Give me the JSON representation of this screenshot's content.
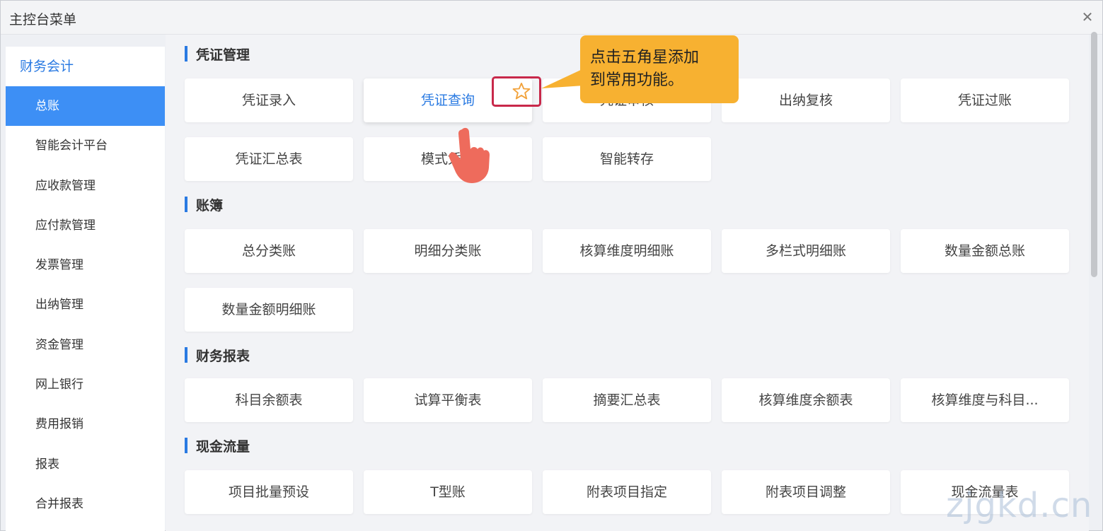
{
  "window": {
    "title": "主控台菜单"
  },
  "sidebar": {
    "module": "财务会计",
    "items": [
      {
        "label": "总账",
        "active": true
      },
      {
        "label": "智能会计平台"
      },
      {
        "label": "应收款管理"
      },
      {
        "label": "应付款管理"
      },
      {
        "label": "发票管理"
      },
      {
        "label": "出纳管理"
      },
      {
        "label": "资金管理"
      },
      {
        "label": "网上银行"
      },
      {
        "label": "费用报销"
      },
      {
        "label": "报表"
      },
      {
        "label": "合并报表"
      }
    ]
  },
  "sections": [
    {
      "title": "凭证管理",
      "tiles": [
        "凭证录入",
        "凭证查询",
        "凭证审核",
        "出纳复核",
        "凭证过账",
        "凭证汇总表",
        "模式凭证",
        "智能转存"
      ]
    },
    {
      "title": "账簿",
      "tiles": [
        "总分类账",
        "明细分类账",
        "核算维度明细账",
        "多栏式明细账",
        "数量金额总账",
        "数量金额明细账"
      ]
    },
    {
      "title": "财务报表",
      "tiles": [
        "科目余额表",
        "试算平衡表",
        "摘要汇总表",
        "核算维度余额表",
        "核算维度与科目..."
      ]
    },
    {
      "title": "现金流量",
      "tiles": [
        "项目批量预设",
        "T型账",
        "附表项目指定",
        "附表项目调整",
        "现金流量表"
      ]
    }
  ],
  "callout": {
    "line1": "点击五角星添加",
    "line2": "到常用功能。"
  },
  "watermark": "zjgkd.cn",
  "colors": {
    "accent": "#2a7ae2",
    "active_bg": "#3d8ff5",
    "callout": "#f7b131",
    "highlight_border": "#c8284a"
  }
}
